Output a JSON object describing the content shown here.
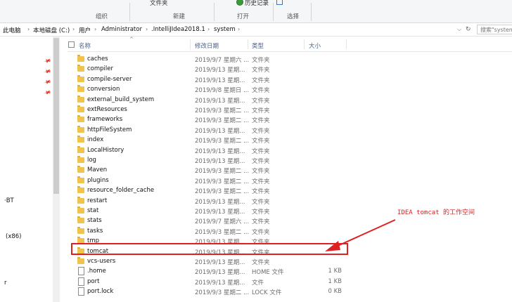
{
  "ribbon": {
    "top_fragments": {
      "folder_label": "文件夹",
      "history": "历史记录"
    },
    "groups": [
      "组织",
      "新建",
      "打开",
      "选择"
    ]
  },
  "address": {
    "crumbs": [
      "此电脑",
      "本地磁盘 (C:)",
      "用户",
      "Administrator",
      ".IntelliJIdea2018.1",
      "system"
    ],
    "search_placeholder": "搜索\"system\""
  },
  "nav": {
    "labels": [
      "·BT",
      "(x86)",
      "r"
    ]
  },
  "columns": {
    "name": "名称",
    "date": "修改日期",
    "type": "类型",
    "size": "大小"
  },
  "files": [
    {
      "name": "caches",
      "date": "2019/9/7 星期六 ...",
      "type": "文件夹",
      "size": "",
      "kind": "folder"
    },
    {
      "name": "compiler",
      "date": "2019/9/13 星期...",
      "type": "文件夹",
      "size": "",
      "kind": "folder"
    },
    {
      "name": "compile-server",
      "date": "2019/9/13 星期...",
      "type": "文件夹",
      "size": "",
      "kind": "folder"
    },
    {
      "name": "conversion",
      "date": "2019/9/8 星期日 ...",
      "type": "文件夹",
      "size": "",
      "kind": "folder"
    },
    {
      "name": "external_build_system",
      "date": "2019/9/13 星期...",
      "type": "文件夹",
      "size": "",
      "kind": "folder"
    },
    {
      "name": "extResources",
      "date": "2019/9/3 星期二 ...",
      "type": "文件夹",
      "size": "",
      "kind": "folder"
    },
    {
      "name": "frameworks",
      "date": "2019/9/3 星期二 ...",
      "type": "文件夹",
      "size": "",
      "kind": "folder"
    },
    {
      "name": "httpFileSystem",
      "date": "2019/9/13 星期...",
      "type": "文件夹",
      "size": "",
      "kind": "folder"
    },
    {
      "name": "index",
      "date": "2019/9/3 星期二 ...",
      "type": "文件夹",
      "size": "",
      "kind": "folder"
    },
    {
      "name": "LocalHistory",
      "date": "2019/9/13 星期...",
      "type": "文件夹",
      "size": "",
      "kind": "folder"
    },
    {
      "name": "log",
      "date": "2019/9/13 星期...",
      "type": "文件夹",
      "size": "",
      "kind": "folder"
    },
    {
      "name": "Maven",
      "date": "2019/9/3 星期二 ...",
      "type": "文件夹",
      "size": "",
      "kind": "folder"
    },
    {
      "name": "plugins",
      "date": "2019/9/3 星期二 ...",
      "type": "文件夹",
      "size": "",
      "kind": "folder"
    },
    {
      "name": "resource_folder_cache",
      "date": "2019/9/3 星期二 ...",
      "type": "文件夹",
      "size": "",
      "kind": "folder"
    },
    {
      "name": "restart",
      "date": "2019/9/13 星期...",
      "type": "文件夹",
      "size": "",
      "kind": "folder"
    },
    {
      "name": "stat",
      "date": "2019/9/13 星期...",
      "type": "文件夹",
      "size": "",
      "kind": "folder"
    },
    {
      "name": "stats",
      "date": "2019/9/7 星期六 ...",
      "type": "文件夹",
      "size": "",
      "kind": "folder"
    },
    {
      "name": "tasks",
      "date": "2019/9/3 星期二 ...",
      "type": "文件夹",
      "size": "",
      "kind": "folder"
    },
    {
      "name": "tmp",
      "date": "2019/9/13 星期...",
      "type": "文件夹",
      "size": "",
      "kind": "folder"
    },
    {
      "name": "tomcat",
      "date": "2019/9/13 星期...",
      "type": "文件夹",
      "size": "",
      "kind": "folder"
    },
    {
      "name": "vcs-users",
      "date": "2019/9/13 星期...",
      "type": "文件夹",
      "size": "",
      "kind": "folder"
    },
    {
      "name": ".home",
      "date": "2019/9/13 星期...",
      "type": "HOME 文件",
      "size": "1 KB",
      "kind": "file"
    },
    {
      "name": "port",
      "date": "2019/9/13 星期...",
      "type": "文件",
      "size": "1 KB",
      "kind": "file"
    },
    {
      "name": "port.lock",
      "date": "2019/9/3 星期二 ...",
      "type": "LOCK 文件",
      "size": "0 KB",
      "kind": "file"
    }
  ],
  "annotation": {
    "text": "IDEA tomcat 的工作空间",
    "color": "#e02020"
  }
}
